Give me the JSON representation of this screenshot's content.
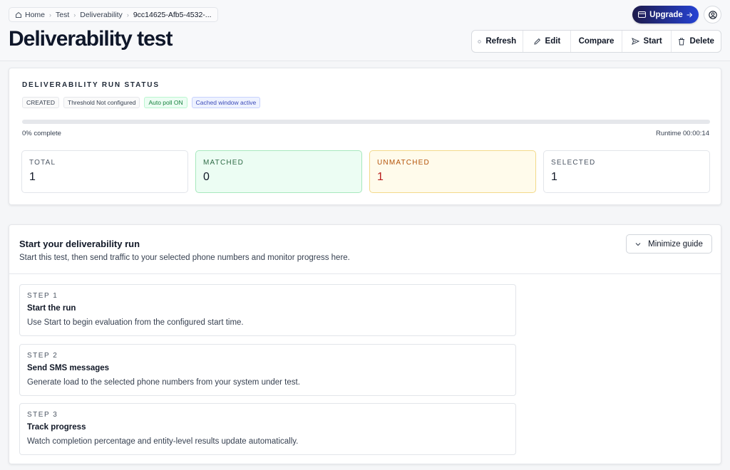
{
  "breadcrumb": {
    "items": [
      "Home",
      "Test",
      "Deliverability",
      "9cc14625-Afb5-4532-..."
    ]
  },
  "header": {
    "upgrade_label": "Upgrade",
    "page_title": "Deliverability test",
    "actions": {
      "refresh": "Refresh",
      "edit": "Edit",
      "compare": "Compare",
      "start": "Start",
      "delete": "Delete"
    }
  },
  "status": {
    "heading": "DELIVERABILITY RUN STATUS",
    "badges": [
      "CREATED",
      "Threshold Not configured",
      "Auto poll ON",
      "Cached window active"
    ],
    "progress_percent": 0,
    "progress_label": "0% complete",
    "runtime": "Runtime 00:00:14",
    "stats": {
      "total": {
        "label": "TOTAL",
        "value": "1"
      },
      "matched": {
        "label": "MATCHED",
        "value": "0"
      },
      "unmatched": {
        "label": "UNMATCHED",
        "value": "1"
      },
      "selected": {
        "label": "SELECTED",
        "value": "1"
      }
    }
  },
  "guide": {
    "title": "Start your deliverability run",
    "subtitle": "Start this test, then send traffic to your selected phone numbers and monitor progress here.",
    "minimize_label": "Minimize guide",
    "steps": [
      {
        "number": "STEP 1",
        "title": "Start the run",
        "description": "Use Start to begin evaluation from the configured start time."
      },
      {
        "number": "STEP 2",
        "title": "Send SMS messages",
        "description": "Generate load to the selected phone numbers from your system under test."
      },
      {
        "number": "STEP 3",
        "title": "Track progress",
        "description": "Watch completion percentage and entity-level results update automatically."
      }
    ]
  },
  "colors": {
    "upgrade_gradient_start": "#1e1b4b",
    "upgrade_gradient_end": "#2542d4",
    "matched_bg": "#ecfdf3",
    "unmatched_bg": "#fffbeb",
    "unmatched_value": "#b91c1c"
  },
  "icons": [
    "home-icon",
    "chevron-right-icon",
    "card-icon",
    "arrow-right-icon",
    "user-circle-icon",
    "refresh-dot-icon",
    "pencil-icon",
    "send-icon",
    "trash-icon",
    "chevron-down-icon"
  ]
}
